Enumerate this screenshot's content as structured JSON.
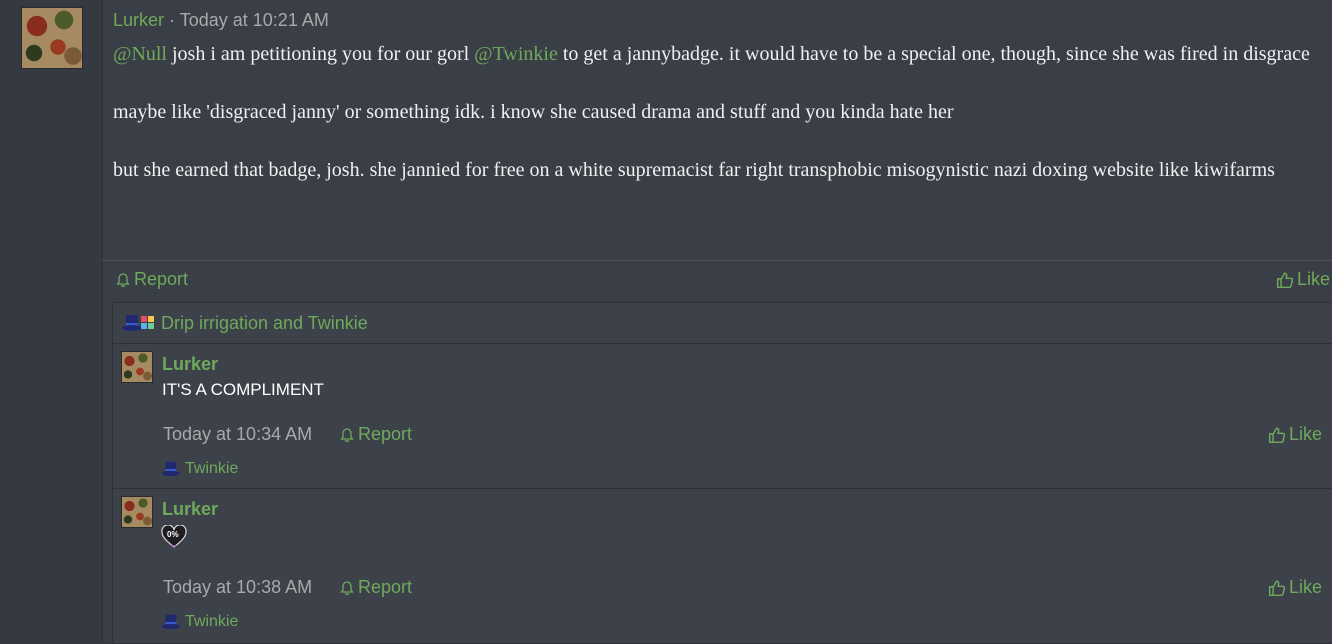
{
  "post": {
    "author": "Lurker",
    "separator": "·",
    "time": "Today at 10:21 AM",
    "mention_null": "@Null",
    "text_1a": " josh i am petitioning you for our gorl ",
    "mention_twinkie": "@Twinkie",
    "text_1b": " to get a jannybadge. it would have to be a special one, though, since she was fired in disgrace",
    "text_2": "maybe like 'disgraced janny' or something idk. i know she caused drama and stuff and you kinda hate her",
    "text_3": "but she earned that badge, josh. she jannied for free on a white supremacist far right transphobic misogynistic nazi doxing website like kiwifarms",
    "report_label": "Report",
    "like_label": "Like"
  },
  "reactions": {
    "text": "Drip irrigation and Twinkie"
  },
  "replies": [
    {
      "author": "Lurker",
      "text": "IT'S A COMPLIMENT",
      "time": "Today at 10:34 AM",
      "report_label": "Report",
      "like_label": "Like",
      "reaction_user": "Twinkie"
    },
    {
      "author": "Lurker",
      "emoji_text": "0%",
      "time": "Today at 10:38 AM",
      "report_label": "Report",
      "like_label": "Like",
      "reaction_user": "Twinkie"
    }
  ],
  "colors": {
    "accent_green": "#6fa95b",
    "background": "#3a3e46",
    "muted_text": "#a9a9a9"
  }
}
